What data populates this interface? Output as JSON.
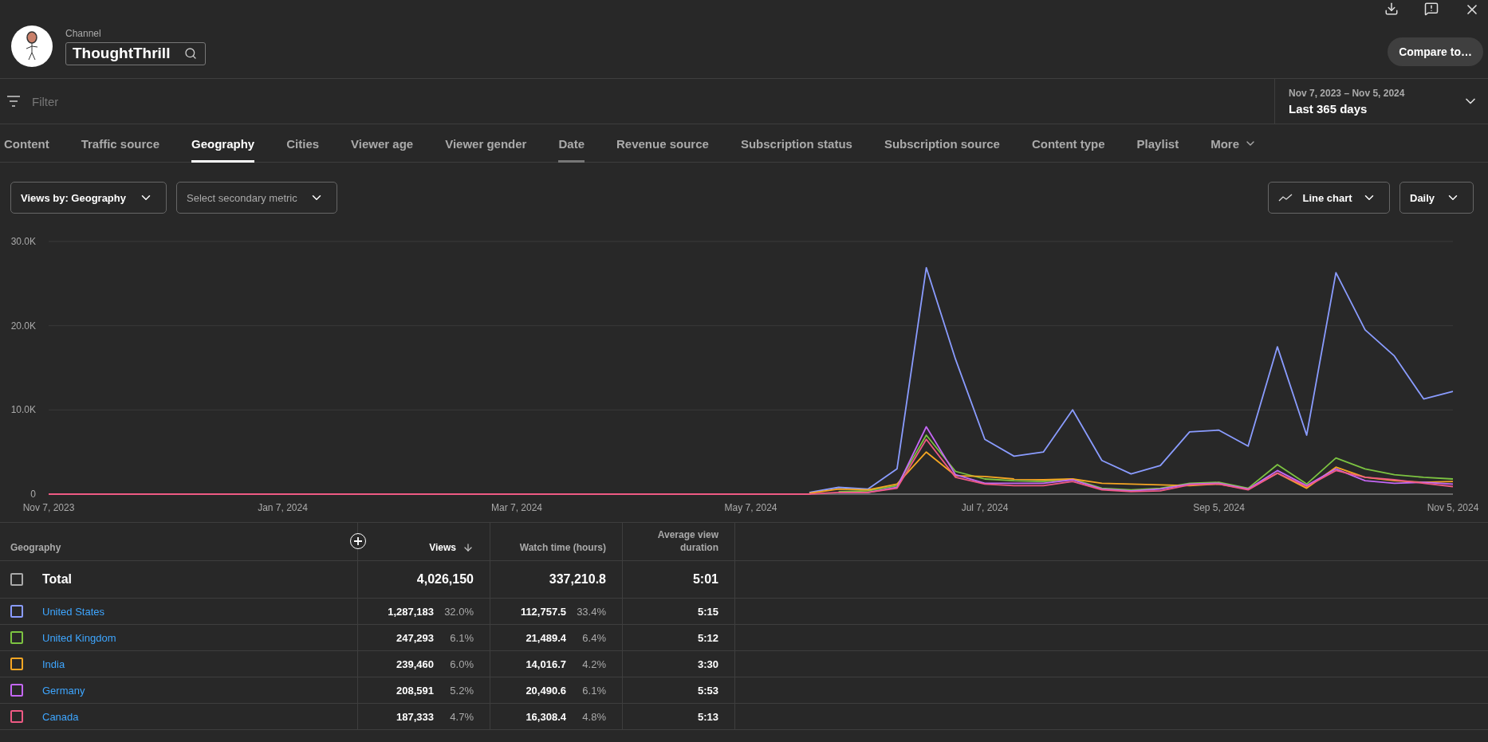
{
  "header": {
    "channel_label": "Channel",
    "channel_name": "ThoughtThrill",
    "compare_button": "Compare to…"
  },
  "filter": {
    "placeholder": "Filter"
  },
  "date_range": {
    "range": "Nov 7, 2023 – Nov 5, 2024",
    "label": "Last 365 days"
  },
  "tabs": [
    {
      "label": "Content",
      "selected": false,
      "hovered": false
    },
    {
      "label": "Traffic source",
      "selected": false,
      "hovered": false
    },
    {
      "label": "Geography",
      "selected": true,
      "hovered": false
    },
    {
      "label": "Cities",
      "selected": false,
      "hovered": false
    },
    {
      "label": "Viewer age",
      "selected": false,
      "hovered": false
    },
    {
      "label": "Viewer gender",
      "selected": false,
      "hovered": false
    },
    {
      "label": "Date",
      "selected": false,
      "hovered": true
    },
    {
      "label": "Revenue source",
      "selected": false,
      "hovered": false
    },
    {
      "label": "Subscription status",
      "selected": false,
      "hovered": false
    },
    {
      "label": "Subscription source",
      "selected": false,
      "hovered": false
    },
    {
      "label": "Content type",
      "selected": false,
      "hovered": false
    },
    {
      "label": "Playlist",
      "selected": false,
      "hovered": false
    },
    {
      "label": "More",
      "selected": false,
      "hovered": false
    }
  ],
  "controls": {
    "primary_metric": "Views by: Geography",
    "secondary_metric": "Select secondary metric",
    "chart_type": "Line chart",
    "interval": "Daily"
  },
  "chart_data": {
    "type": "line",
    "ylim": [
      0,
      30000
    ],
    "categories": [
      "Nov 7, 2023",
      null,
      null,
      null,
      null,
      null,
      null,
      null,
      "Jan 7, 2024",
      null,
      null,
      null,
      null,
      null,
      null,
      null,
      "Mar 7, 2024",
      null,
      null,
      null,
      null,
      null,
      null,
      null,
      "May 7, 2024",
      null,
      null,
      null,
      null,
      null,
      null,
      null,
      "Jul 7, 2024",
      null,
      null,
      null,
      null,
      null,
      null,
      null,
      "Sep 5, 2024",
      null,
      null,
      null,
      null,
      null,
      null,
      null,
      "Nov 5, 2024"
    ],
    "yticks": [
      {
        "value": 0,
        "label": "0"
      },
      {
        "value": 10000,
        "label": "10.0K"
      },
      {
        "value": 20000,
        "label": "20.0K"
      },
      {
        "value": 30000,
        "label": "30.0K"
      }
    ],
    "series": [
      {
        "color": "#8a9cff",
        "values": [
          null,
          null,
          null,
          null,
          null,
          null,
          null,
          null,
          null,
          null,
          null,
          null,
          null,
          null,
          null,
          null,
          null,
          null,
          null,
          null,
          null,
          null,
          null,
          null,
          null,
          null,
          200,
          800,
          600,
          3000,
          26900,
          16000,
          6500,
          4500,
          5000,
          10000,
          4000,
          2400,
          3400,
          7400,
          7600,
          5700,
          17500,
          7000,
          26300,
          19500,
          16400,
          11300,
          12200
        ]
      },
      {
        "color": "#7cc341",
        "values": [
          null,
          null,
          null,
          null,
          null,
          null,
          null,
          null,
          null,
          null,
          null,
          null,
          null,
          null,
          null,
          null,
          null,
          null,
          null,
          null,
          null,
          null,
          null,
          null,
          null,
          null,
          null,
          300,
          400,
          1000,
          7000,
          2700,
          1800,
          1600,
          1500,
          1800,
          700,
          500,
          700,
          1300,
          1400,
          700,
          3500,
          1200,
          4300,
          3000,
          2300,
          2000,
          1800
        ]
      },
      {
        "color": "#f5a623",
        "values": [
          null,
          null,
          null,
          null,
          null,
          null,
          null,
          null,
          null,
          null,
          null,
          null,
          null,
          null,
          null,
          null,
          null,
          null,
          null,
          null,
          null,
          null,
          null,
          null,
          null,
          null,
          100,
          600,
          500,
          1200,
          5000,
          2200,
          2100,
          1800,
          1700,
          1800,
          1300,
          1200,
          1100,
          1000,
          1200,
          600,
          2500,
          700,
          3200,
          2000,
          1600,
          1400,
          1500
        ]
      },
      {
        "color": "#c467f5",
        "values": [
          null,
          null,
          null,
          null,
          null,
          null,
          null,
          null,
          null,
          null,
          null,
          null,
          null,
          null,
          null,
          null,
          null,
          null,
          null,
          null,
          null,
          null,
          null,
          null,
          null,
          null,
          null,
          200,
          200,
          800,
          8000,
          2300,
          1300,
          1300,
          1300,
          1700,
          600,
          400,
          600,
          1200,
          1300,
          600,
          2800,
          1000,
          3000,
          1600,
          1300,
          1400,
          1200
        ]
      },
      {
        "color": "#ef5a84",
        "values": [
          0,
          0,
          0,
          0,
          0,
          0,
          0,
          0,
          0,
          0,
          0,
          0,
          0,
          0,
          0,
          0,
          0,
          0,
          0,
          0,
          0,
          0,
          0,
          0,
          0,
          0,
          0,
          200,
          200,
          700,
          6500,
          2000,
          1200,
          1000,
          1000,
          1500,
          500,
          300,
          400,
          1100,
          1200,
          500,
          2500,
          900,
          2800,
          2000,
          1700,
          1300,
          900
        ]
      }
    ]
  },
  "table": {
    "columns": [
      {
        "label": "Geography",
        "sorted": false
      },
      {
        "label": "Views",
        "sorted": true
      },
      {
        "label": "Watch time (hours)",
        "sorted": false
      },
      {
        "label": "Average view duration",
        "sorted": false
      }
    ],
    "total": {
      "label": "Total",
      "checked": false,
      "views": "4,026,150",
      "watch_time": "337,210.8",
      "avg_duration": "5:01"
    },
    "rows": [
      {
        "name": "United States",
        "color": "#8a9cff",
        "checked": false,
        "views": "1,287,183",
        "views_pct": "32.0%",
        "watch_time": "112,757.5",
        "watch_pct": "33.4%",
        "avg_duration": "5:15"
      },
      {
        "name": "United Kingdom",
        "color": "#7cc341",
        "checked": false,
        "views": "247,293",
        "views_pct": "6.1%",
        "watch_time": "21,489.4",
        "watch_pct": "6.4%",
        "avg_duration": "5:12"
      },
      {
        "name": "India",
        "color": "#f5a623",
        "checked": false,
        "views": "239,460",
        "views_pct": "6.0%",
        "watch_time": "14,016.7",
        "watch_pct": "4.2%",
        "avg_duration": "3:30"
      },
      {
        "name": "Germany",
        "color": "#c467f5",
        "checked": false,
        "views": "208,591",
        "views_pct": "5.2%",
        "watch_time": "20,490.6",
        "watch_pct": "6.1%",
        "avg_duration": "5:53"
      },
      {
        "name": "Canada",
        "color": "#ef5a84",
        "checked": false,
        "views": "187,333",
        "views_pct": "4.7%",
        "watch_time": "16,308.4",
        "watch_pct": "4.8%",
        "avg_duration": "5:13"
      }
    ]
  }
}
